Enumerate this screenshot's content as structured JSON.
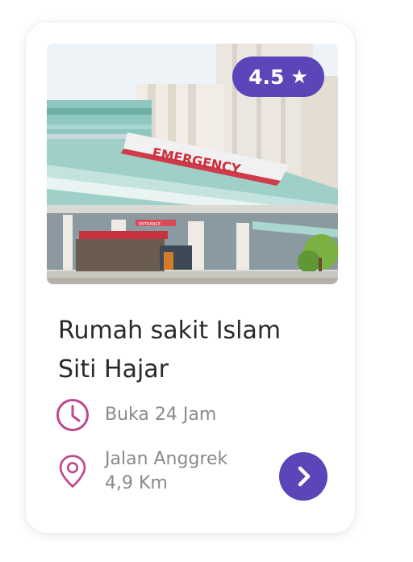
{
  "card": {
    "rating": {
      "value": "4.5",
      "star_icon": "star-icon"
    },
    "image_sign": "EMERGENCY",
    "image_small_sign": "ENTRANCE",
    "title_line1": "Rumah sakit Islam",
    "title_line2": "Siti Hajar",
    "hours": {
      "icon": "clock-icon",
      "text": "Buka 24 Jam"
    },
    "address": {
      "icon": "location-pin-icon",
      "street": "Jalan Anggrek",
      "distance": "4,9 Km"
    },
    "go_button": {
      "icon": "chevron-right-icon"
    }
  },
  "colors": {
    "accent": "#5b45b8",
    "icon": "#c0478e",
    "title": "#2a2a2a",
    "muted": "#8a8a8a"
  }
}
